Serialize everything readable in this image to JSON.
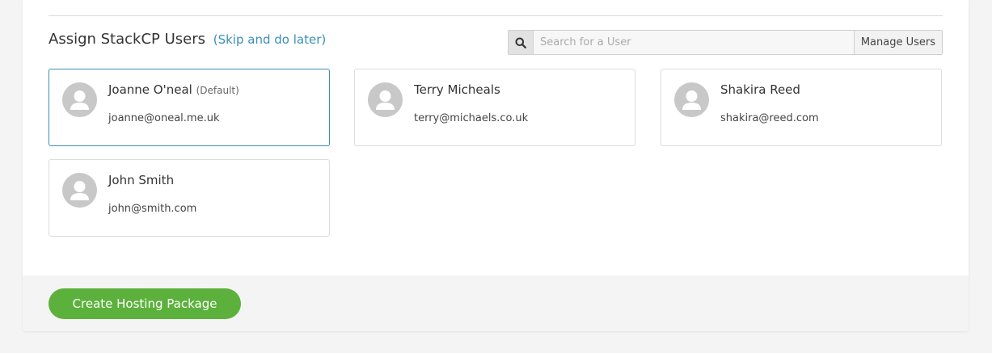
{
  "section": {
    "title": "Assign StackCP Users",
    "skip_label": "(Skip and do later)"
  },
  "search": {
    "placeholder": "Search for a User",
    "value": "",
    "icon": "search-icon",
    "manage_label": "Manage Users"
  },
  "users": [
    {
      "name": "Joanne O'neal",
      "tag": "(Default)",
      "email": "joanne@oneal.me.uk",
      "selected": true
    },
    {
      "name": "Terry Micheals",
      "tag": "",
      "email": "terry@michaels.co.uk",
      "selected": false
    },
    {
      "name": "Shakira Reed",
      "tag": "",
      "email": "shakira@reed.com",
      "selected": false
    },
    {
      "name": "John Smith",
      "tag": "",
      "email": "john@smith.com",
      "selected": false
    }
  ],
  "footer": {
    "create_label": "Create Hosting Package"
  },
  "colors": {
    "accent": "#3a8fb7",
    "create_button": "#5cb13c",
    "avatar": "#c8c8c8"
  }
}
